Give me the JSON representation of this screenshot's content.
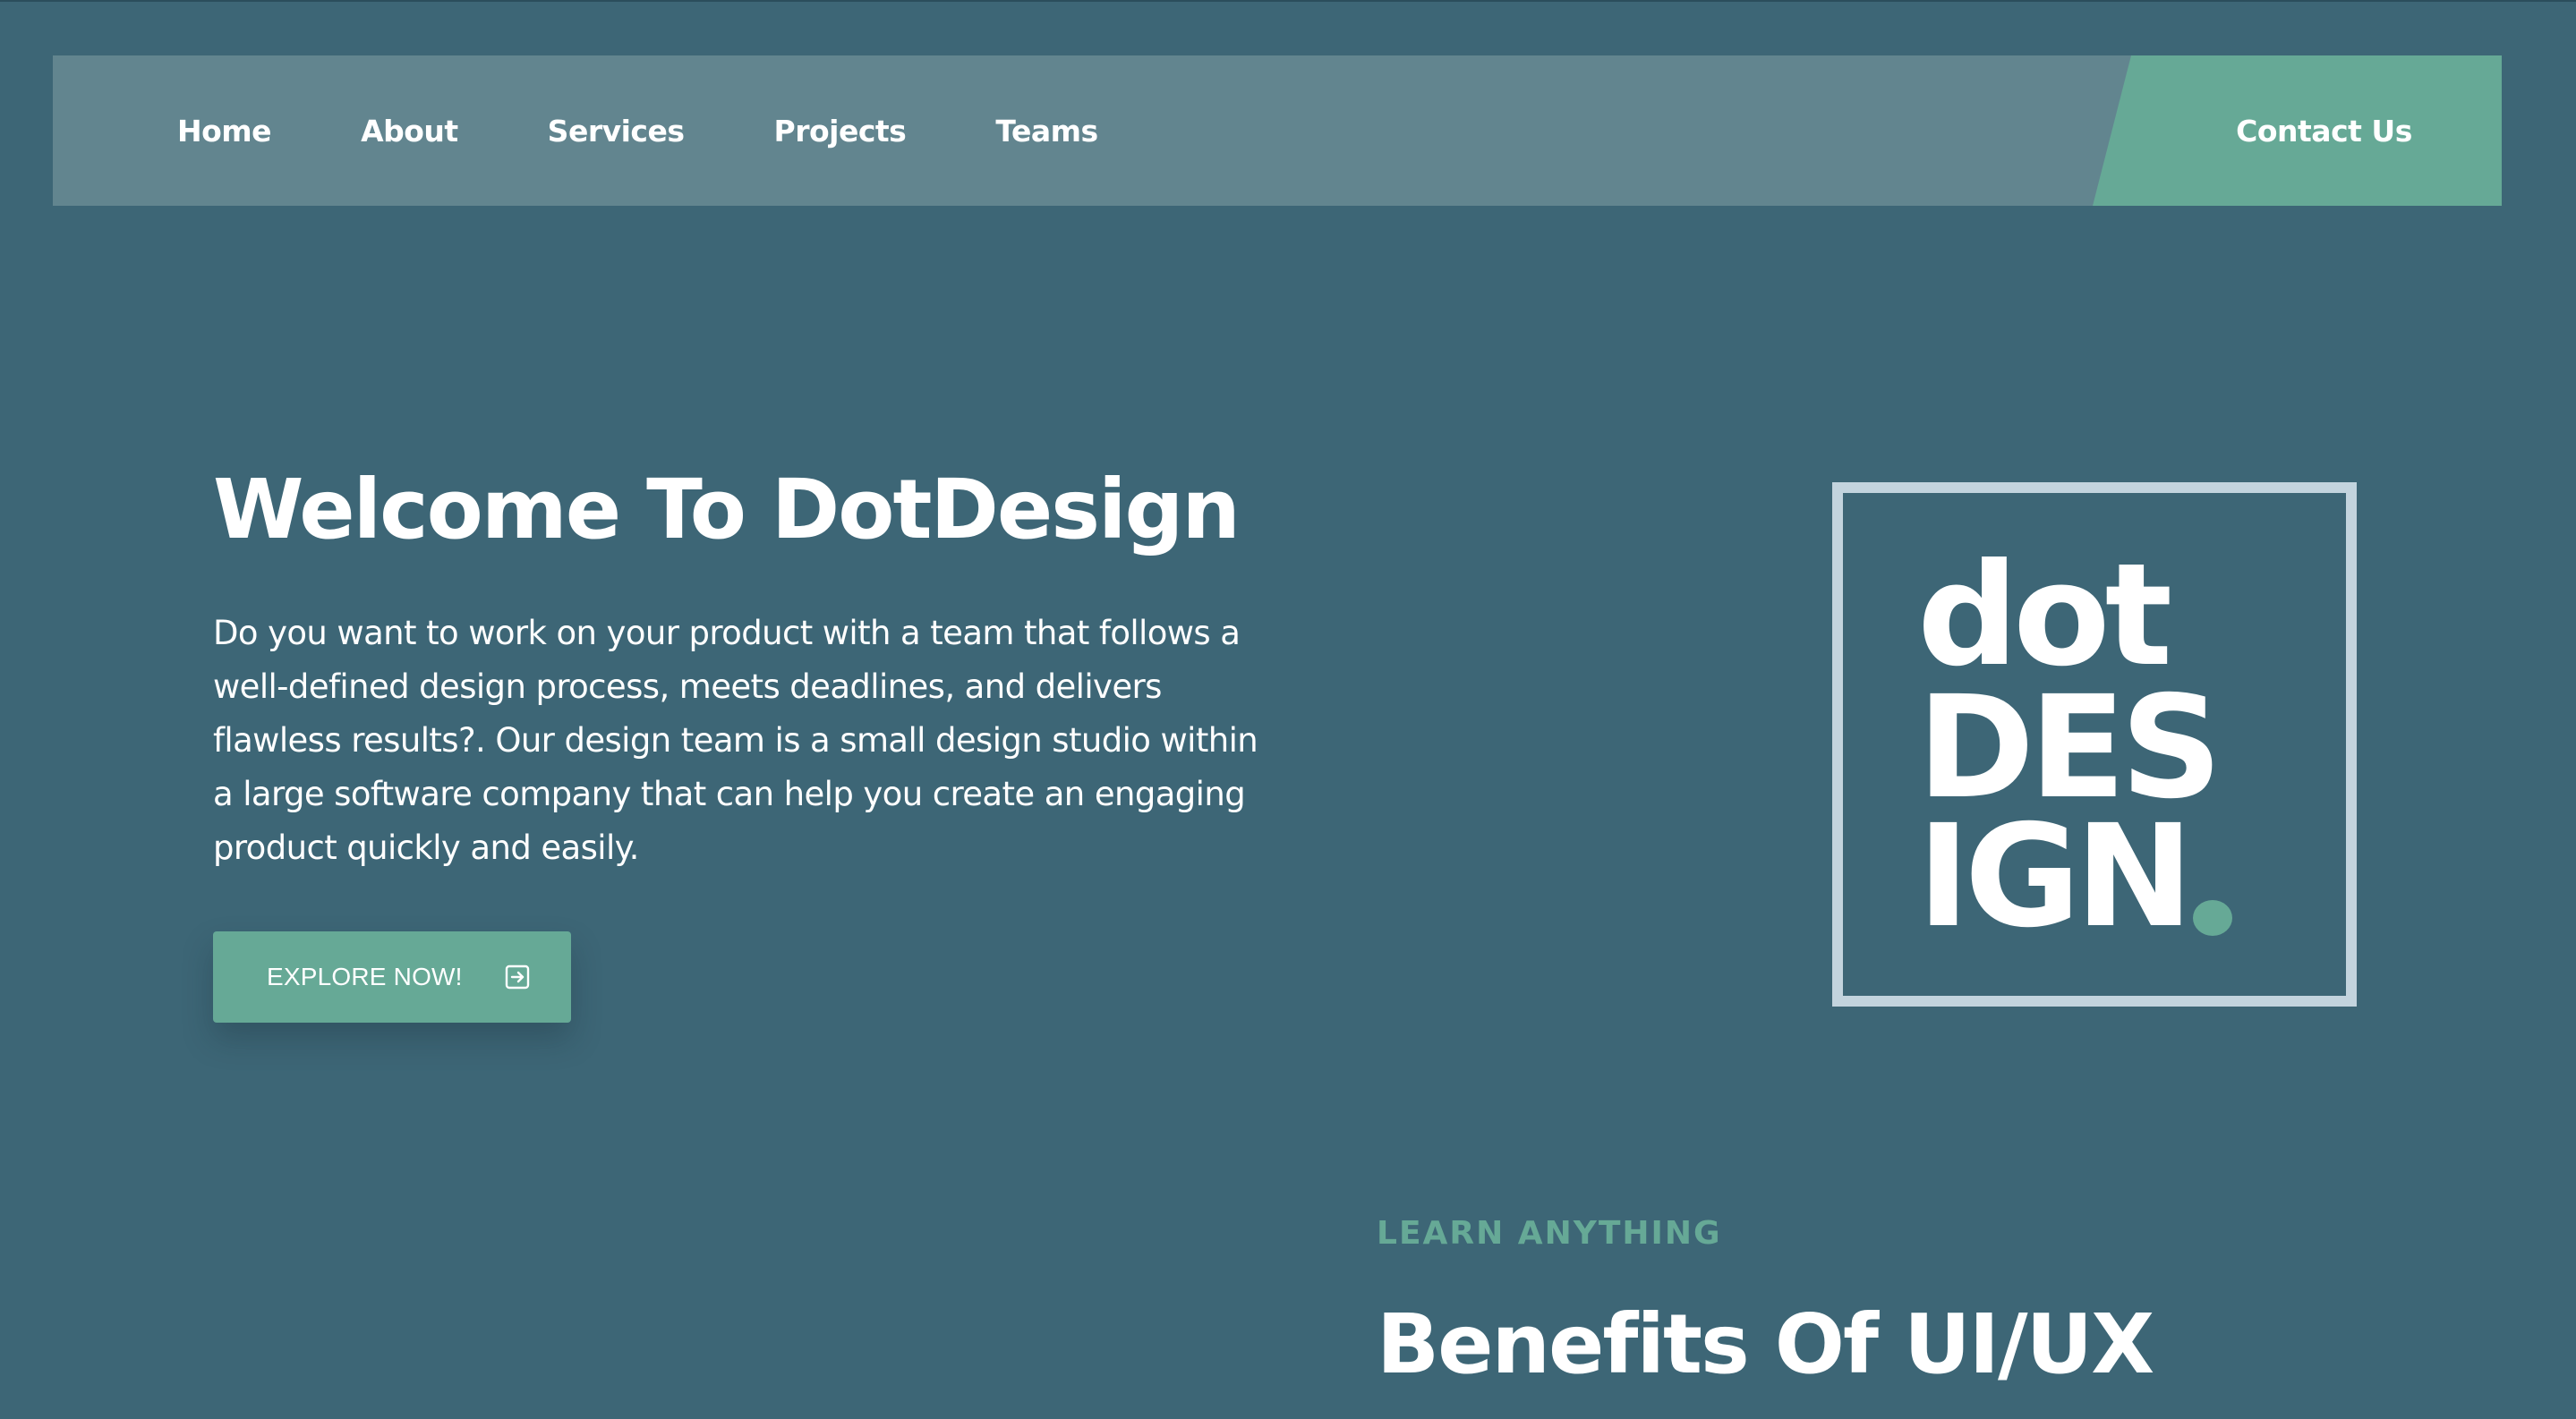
{
  "nav": {
    "items": [
      {
        "label": "Home"
      },
      {
        "label": "About"
      },
      {
        "label": "Services"
      },
      {
        "label": "Projects"
      },
      {
        "label": "Teams"
      }
    ],
    "contact_label": "Contact Us"
  },
  "hero": {
    "title": "Welcome To DotDesign",
    "description": "Do you want to work on your product with a team that follows a well-defined design process, meets deadlines, and delivers flawless results?. Our design team is a small design studio within a large software company that can help you create an engaging product quickly and easily.",
    "button_label": "EXPLORE NOW!",
    "button_icon": "arrow-right-box-icon"
  },
  "logo": {
    "line1": "dot",
    "line2": "DES",
    "line3": "IGN"
  },
  "benefits": {
    "eyebrow": "LEARN ANYTHING",
    "title": "Benefits Of UI/UX"
  },
  "colors": {
    "background": "#3d6676",
    "nav_bar": "#62858f",
    "accent": "#66a996",
    "logo_border": "#c3d4de",
    "text": "#ffffff"
  }
}
